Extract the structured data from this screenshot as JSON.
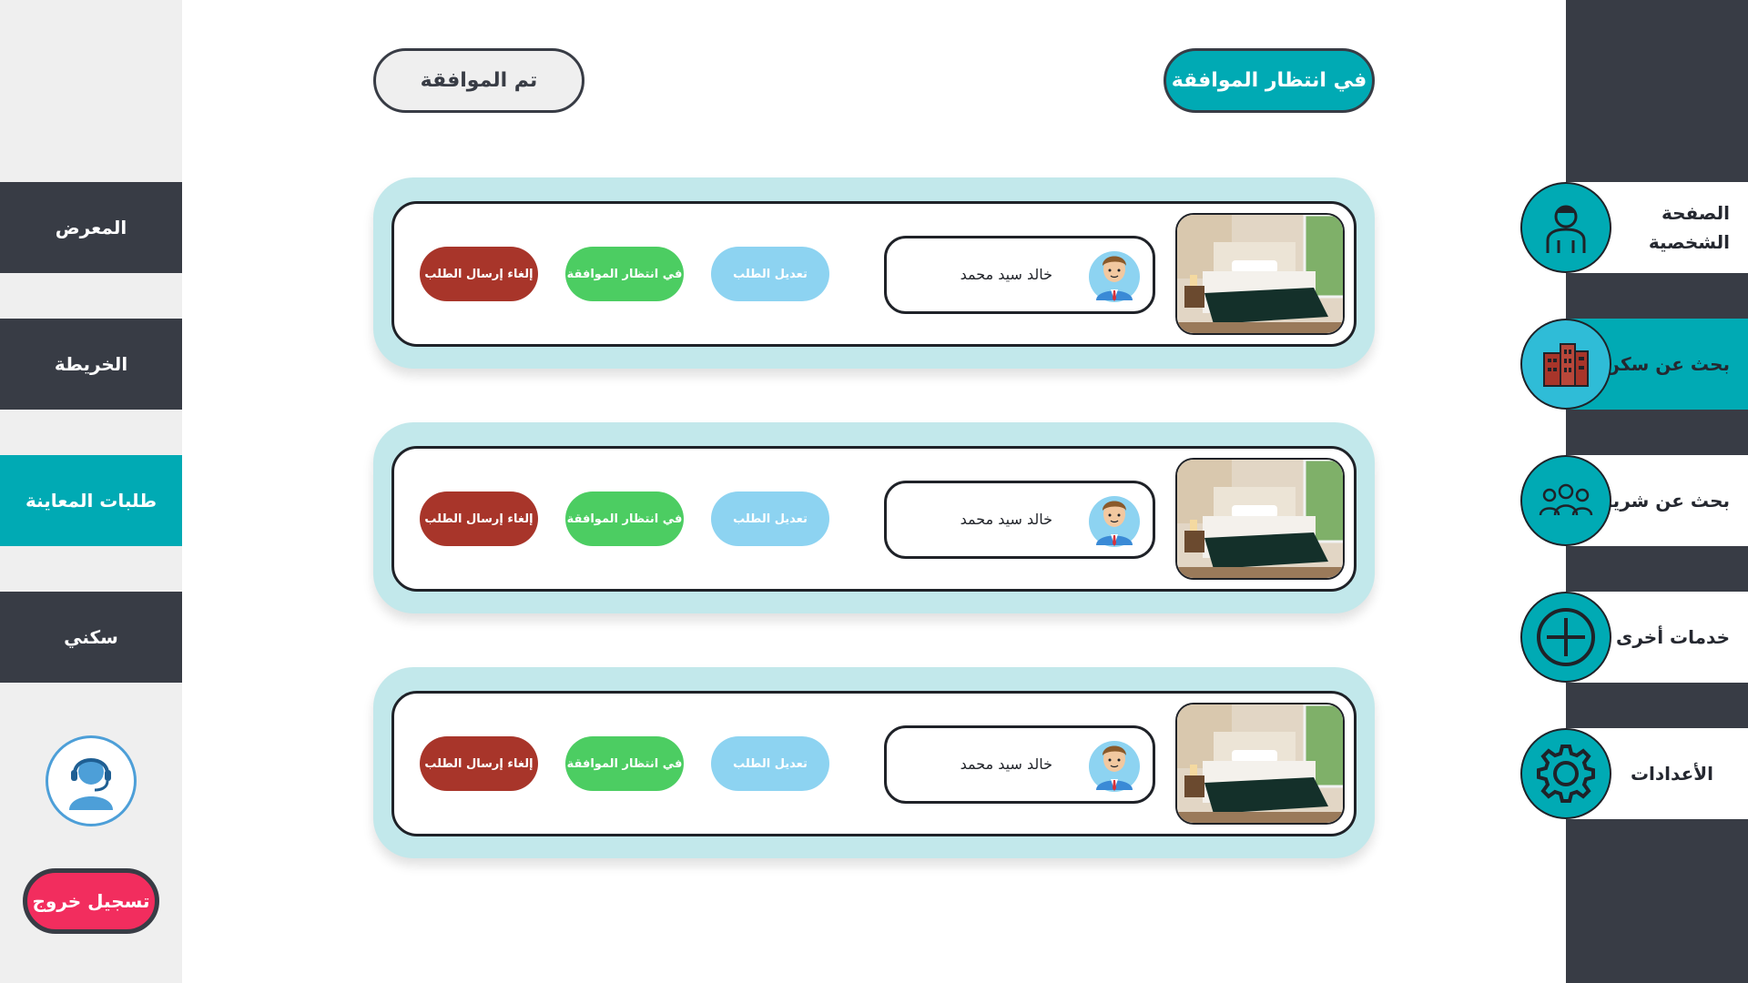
{
  "left_menu": {
    "items": [
      {
        "label": "المعرض"
      },
      {
        "label": "الخريطة"
      },
      {
        "label": "طلبات المعاينة"
      },
      {
        "label": "سكني"
      }
    ],
    "logout_label": "تسجيل خروج"
  },
  "right_menu": {
    "items": [
      {
        "label": "الصفحة الشخصية",
        "icon": "user-icon"
      },
      {
        "label": "بحث عن سكن",
        "icon": "building-icon"
      },
      {
        "label": "بحث عن شريك",
        "icon": "group-icon"
      },
      {
        "label": "خدمات أخرى",
        "icon": "plus-circle-icon"
      },
      {
        "label": "الأعدادات",
        "icon": "gear-icon"
      }
    ]
  },
  "tabs": {
    "pending": "في انتظار الموافقة",
    "approved": "تم الموافقة"
  },
  "requests": [
    {
      "name": "خالد سيد محمد",
      "edit": "تعديل الطلب",
      "status": "في انتظار الموافقة",
      "cancel": "إلغاء إرسال الطلب"
    },
    {
      "name": "خالد سيد محمد",
      "edit": "تعديل الطلب",
      "status": "في انتظار الموافقة",
      "cancel": "إلغاء إرسال الطلب"
    },
    {
      "name": "خالد سيد محمد",
      "edit": "تعديل الطلب",
      "status": "في انتظار الموافقة",
      "cancel": "إلغاء إرسال الطلب"
    }
  ],
  "colors": {
    "teal": "#00aab4",
    "dark": "#383c45",
    "card_bg": "#c2e8eb",
    "edit": "#8dd3f1",
    "pending": "#4ccd62",
    "cancel": "#a8352a",
    "logout": "#f22d5e"
  }
}
